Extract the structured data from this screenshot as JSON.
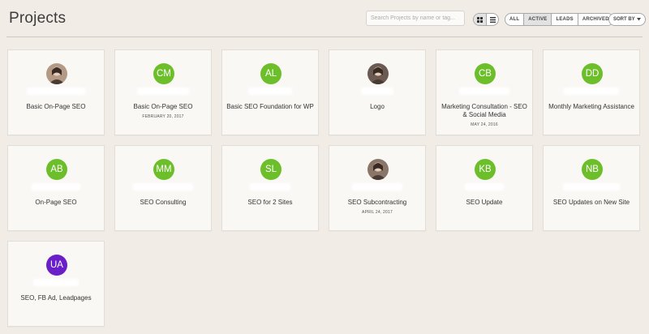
{
  "header": {
    "title": "Projects",
    "search_placeholder": "Search Projects by name or tag...",
    "view_grid_icon": "grid-icon",
    "view_list_icon": "list-icon",
    "filters": [
      "ALL",
      "ACTIVE",
      "LEADS",
      "ARCHIVED"
    ],
    "active_filter": "ACTIVE",
    "sort_label": "SORT BY"
  },
  "projects": [
    {
      "initials": "",
      "avatar": "photo",
      "color": "#b49a84",
      "name": "Basic On-Page SEO",
      "date": ""
    },
    {
      "initials": "CM",
      "color": "#6cbf2a",
      "name": "Basic On-Page SEO",
      "date": "FEBRUARY 20, 2017"
    },
    {
      "initials": "AL",
      "color": "#6cbf2a",
      "name": "Basic SEO Foundation for WP",
      "date": ""
    },
    {
      "initials": "",
      "avatar": "photo",
      "color": "#6a5a52",
      "name": "Logo",
      "date": ""
    },
    {
      "initials": "CB",
      "color": "#6cbf2a",
      "name": "Marketing Consultation - SEO & Social Media",
      "date": "MAY 24, 2016"
    },
    {
      "initials": "DD",
      "color": "#6cbf2a",
      "name": "Monthly Marketing Assistance",
      "date": ""
    },
    {
      "initials": "AB",
      "color": "#6cbf2a",
      "name": "On-Page SEO",
      "date": ""
    },
    {
      "initials": "MM",
      "color": "#6cbf2a",
      "name": "SEO Consulting",
      "date": ""
    },
    {
      "initials": "SL",
      "color": "#6cbf2a",
      "name": "SEO for 2 Sites",
      "date": ""
    },
    {
      "initials": "",
      "avatar": "photo",
      "color": "#8a7668",
      "name": "SEO Subcontracting",
      "date": "APRIL 24, 2017"
    },
    {
      "initials": "KB",
      "color": "#6cbf2a",
      "name": "SEO Update",
      "date": ""
    },
    {
      "initials": "NB",
      "color": "#6cbf2a",
      "name": "SEO Updates on New Site",
      "date": ""
    },
    {
      "initials": "UA",
      "color": "#6a1fc9",
      "name": "SEO, FB Ad, Leadpages",
      "date": ""
    }
  ]
}
